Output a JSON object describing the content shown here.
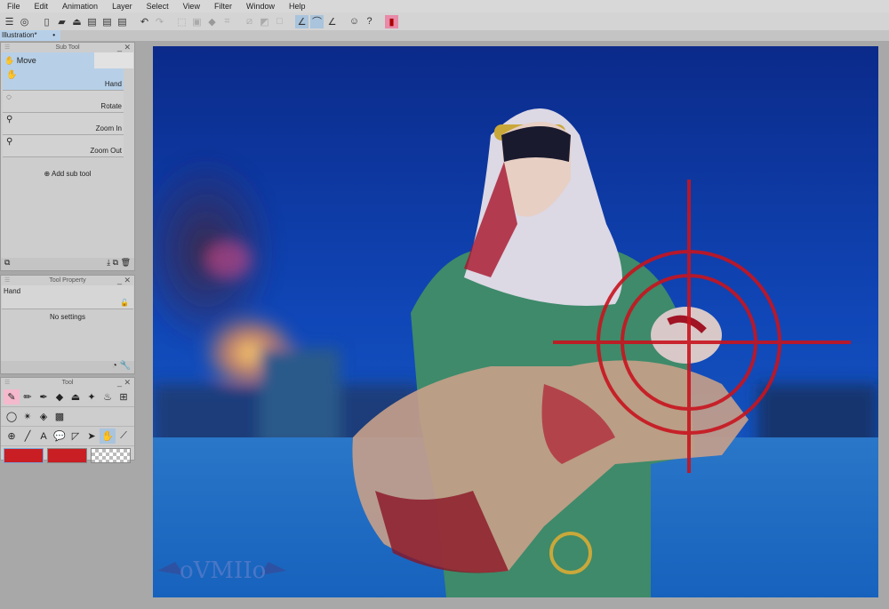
{
  "menu": [
    "File",
    "Edit",
    "Animation",
    "Layer",
    "Select",
    "View",
    "Filter",
    "Window",
    "Help"
  ],
  "toolbar_icons": [
    "menu-icon",
    "clip-icon",
    "new-icon",
    "open-icon",
    "save-icon",
    "export-icon",
    "export-icon",
    "export-icon",
    "undo-icon",
    "redo-icon",
    "select-icon",
    "crop-icon",
    "fill-icon",
    "transform-icon",
    "clear-icon",
    "gradient-icon",
    "frame-icon",
    "ruler-snap-icon",
    "curve-snap-icon",
    "line-snap-icon",
    "companion-icon",
    "help-icon",
    "account-icon"
  ],
  "document_tab": {
    "label": "Illustration*",
    "dot": "•"
  },
  "subtool": {
    "title": "Sub Tool",
    "group": "Move",
    "items": [
      {
        "label": "Hand",
        "icon": "✋"
      },
      {
        "label": "Rotate",
        "icon": "◌"
      },
      {
        "label": "Zoom In",
        "icon": "⚲"
      },
      {
        "label": "Zoom Out",
        "icon": "⚲"
      }
    ],
    "add_label": "Add sub tool"
  },
  "tool_property": {
    "title": "Tool Property",
    "tool_name": "Hand",
    "message": "No settings"
  },
  "tool_panel": {
    "title": "Tool"
  },
  "colors": {
    "main": "#c81e24",
    "sub": "#c81e24",
    "accent": "#a9c4dc"
  },
  "signature": "oVMIIo"
}
